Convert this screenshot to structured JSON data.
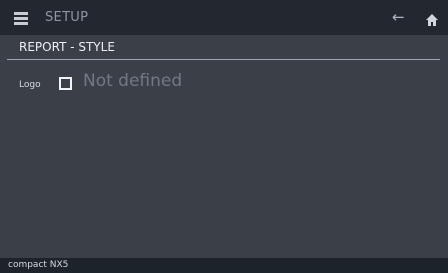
{
  "header": {
    "title": "SETUP",
    "menu_icon": "menu-icon",
    "back_icon": "back-arrow-icon",
    "home_icon": "home-icon"
  },
  "section": {
    "title": "REPORT - STYLE"
  },
  "logo": {
    "label": "Logo",
    "checked": false,
    "value": "Not defined"
  },
  "footer": {
    "device": "compact NX5"
  },
  "colors": {
    "background": "#3a3f48",
    "topbar": "#232830",
    "footer": "#1d232b",
    "title_text": "#8b97a7",
    "placeholder_text": "#737984"
  }
}
